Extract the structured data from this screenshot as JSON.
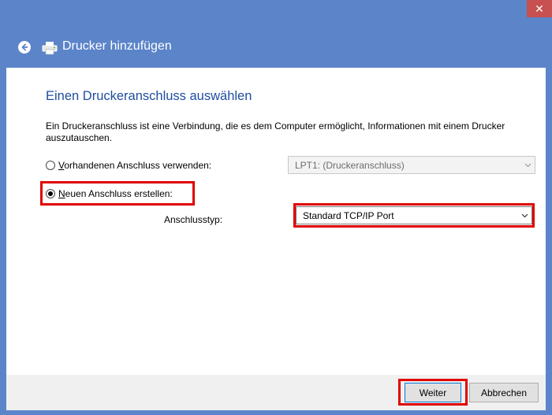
{
  "window": {
    "title": "Drucker hinzufügen",
    "close_glyph": "✕"
  },
  "page": {
    "heading": "Einen Druckeranschluss auswählen",
    "description": "Ein Druckeranschluss ist eine Verbindung, die es dem Computer ermöglicht, Informationen mit einem Drucker auszutauschen."
  },
  "options": {
    "existing_port_label": "Vorhandenen Anschluss verwenden:",
    "existing_port_checked": false,
    "existing_port_value": "LPT1: (Druckeranschluss)",
    "new_port_label": "Neuen Anschluss erstellen:",
    "new_port_checked": true,
    "port_type_label": "Anschlusstyp:",
    "port_type_value": "Standard TCP/IP Port"
  },
  "buttons": {
    "next": "Weiter",
    "cancel": "Abbrechen"
  },
  "colors": {
    "titlebar": "#5b84c9",
    "heading": "#1f4ea1",
    "highlight": "#e00000",
    "close": "#c75050"
  },
  "icons": [
    "back-arrow-icon",
    "printer-icon",
    "close-icon",
    "chevron-down-icon"
  ]
}
